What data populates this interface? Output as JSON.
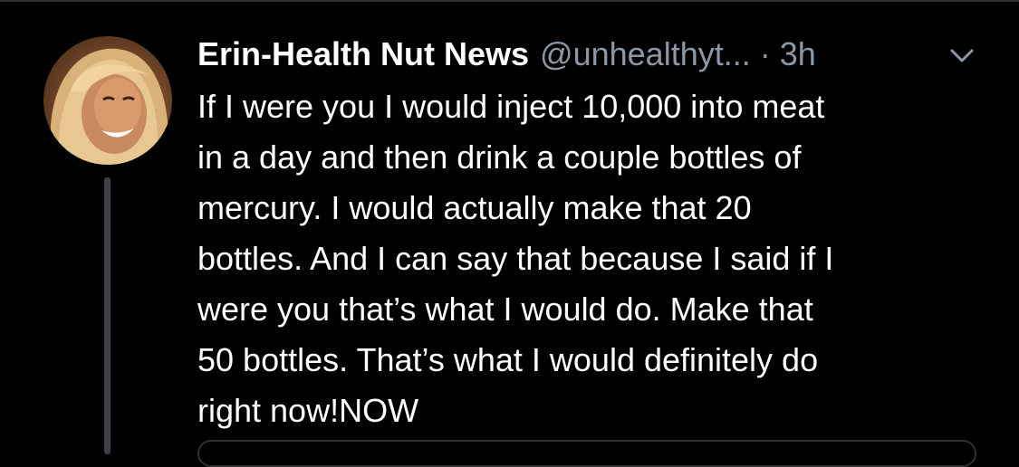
{
  "tweet": {
    "author_name": "Erin-Health Nut News",
    "handle": "@unhealthyt...",
    "separator": "·",
    "timestamp": "3h",
    "text_lines": [
      "If I were you I would inject 10,000 into meat",
      "in a day and then drink a couple bottles of",
      "mercury. I would actually make that 20",
      "bottles. And I can say that because I said if I",
      "were you that’s what I would do. Make that",
      "50 bottles. That’s what I would definitely do",
      "right now!NOW"
    ],
    "caret_icon": "chevron-down-icon",
    "avatar_icon": "avatar"
  },
  "colors": {
    "background": "#000000",
    "primary_text": "#ffffff",
    "secondary_text": "#8b98a5",
    "divider": "#2f3336",
    "thread_line": "#3d4147"
  }
}
